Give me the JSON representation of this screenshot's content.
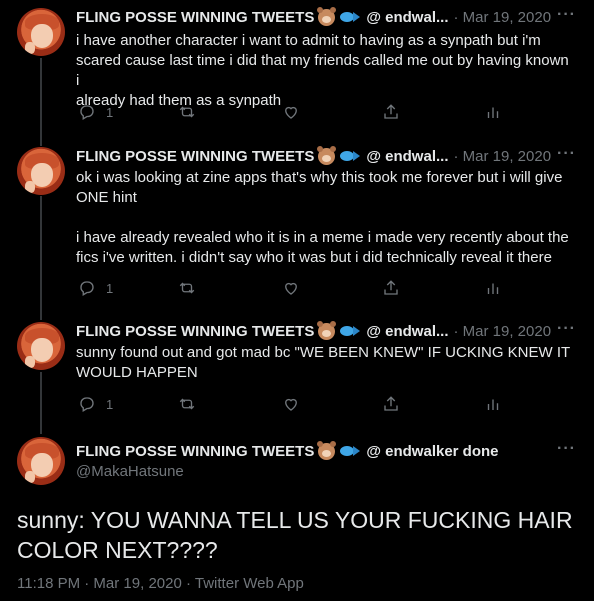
{
  "thread": [
    {
      "display_name": "FLING POSSE WINNING TWEETS",
      "emoji_icons": [
        "bear-face-icon",
        "fish-icon"
      ],
      "at_name": "@ endwal...",
      "time": "· Mar 19, 2020",
      "text": "i have another character i want to admit to having as a synpath but i'm\nscared cause last time i did that my friends called me out by having known i\nalready had them as a synpath",
      "reply_count": "1",
      "retweet_count": "",
      "like_count": ""
    },
    {
      "display_name": "FLING POSSE WINNING TWEETS",
      "emoji_icons": [
        "bear-face-icon",
        "fish-icon"
      ],
      "at_name": "@ endwal...",
      "time": "· Mar 19, 2020",
      "text": "ok i was looking at zine apps that's why this took me forever but i will give\nONE hint\n\ni have already revealed who it is in a meme i made very recently about the\nfics i've written. i didn't say who it was but i did technically reveal it there",
      "reply_count": "1",
      "retweet_count": "",
      "like_count": ""
    },
    {
      "display_name": "FLING POSSE WINNING TWEETS",
      "emoji_icons": [
        "bear-face-icon",
        "fish-icon"
      ],
      "at_name": "@ endwal...",
      "time": "· Mar 19, 2020",
      "text": "sunny found out and got mad bc \"WE BEEN KNEW\" IF UCKING KNEW IT\nWOULD HAPPEN",
      "reply_count": "1",
      "retweet_count": "",
      "like_count": ""
    }
  ],
  "main_tweet": {
    "display_name": "FLING POSSE WINNING TWEETS",
    "emoji_icons": [
      "bear-face-icon",
      "fish-icon"
    ],
    "at_name": "@ endwalker done",
    "handle": "@MakaHatsune",
    "text": "sunny: YOU WANNA TELL US YOUR FUCKING HAIR\nCOLOR NEXT????",
    "time": "11:18 PM",
    "date": "· Mar 19, 2020 ·",
    "source": "Twitter Web App"
  },
  "colors": {
    "background": "#000000",
    "text_primary": "#e7e9ea",
    "text_secondary": "#71767b",
    "thread_line": "#333639"
  }
}
